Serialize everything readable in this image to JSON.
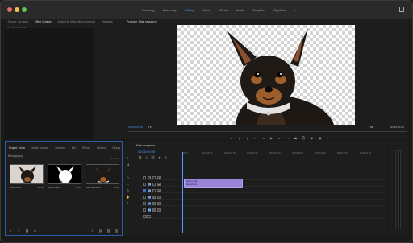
{
  "workspace_tabs": [
    "Learning",
    "Assembly",
    "Editing",
    "Color",
    "Effects",
    "Audio",
    "Graphics",
    "Captions"
  ],
  "workspace_active": 2,
  "workspace_more": "»",
  "left_top": {
    "tabs": [
      "Source: (no clips)",
      "Effect Controls",
      "Audio Clip Mixer: Main sequence",
      "Metadata"
    ],
    "active_tab": 1,
    "label": "(no clip selected)"
  },
  "program": {
    "title": "Program: Main sequence",
    "timecode_left": "00:00:00:00",
    "fit": "Fit",
    "full": "Full",
    "timecode_right": "00:00:10:20"
  },
  "project": {
    "tabs": [
      "Project: Demo",
      "Media Browser",
      "Libraries",
      "Info",
      "Effects",
      "Markers",
      "History"
    ],
    "active_tab": 0,
    "toolbar_label": "Workspaces",
    "name": "Demo.prproj",
    "count": "3 items",
    "items": [
      {
        "name": "Dachshund",
        "duration": "10:20"
      },
      {
        "name": "Alpha mask",
        "duration": "10:20"
      },
      {
        "name": "Main sequence",
        "duration": "10:20"
      }
    ]
  },
  "timeline": {
    "title": "Main sequence",
    "timecode": "00:00:00:00",
    "ruler": [
      "00:00",
      "00:00:00:00",
      "00:00:02:00",
      "00:00:04:00",
      "00:00:06:00",
      "00:00:08:00",
      "00:00:10:00",
      "00:00:12:00",
      "00:00:14:00"
    ],
    "tracks": [
      "V3",
      "V2",
      "V1",
      "A1",
      "A2",
      "A3",
      "Mix"
    ],
    "clip_labels": [
      "Alpha mask",
      "Dachshund"
    ]
  },
  "colors": {
    "accent": "#4d9fff",
    "clip": "#9a84d9",
    "panel": "#1d1d1d"
  }
}
